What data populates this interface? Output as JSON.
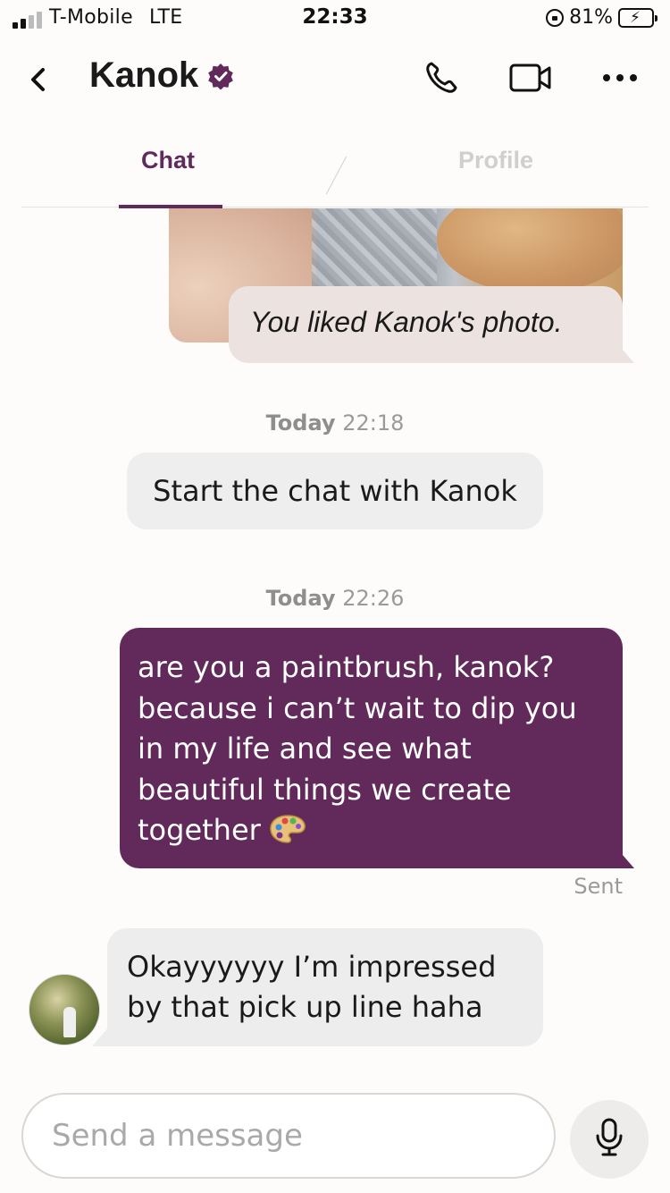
{
  "status_bar": {
    "carrier": "T-Mobile",
    "network": "LTE",
    "time": "22:33",
    "battery_percent": "81%",
    "battery_level": 0.81
  },
  "header": {
    "name": "Kanok",
    "icons": [
      "back-icon",
      "verified-badge-icon",
      "phone-icon",
      "video-icon",
      "more-icon"
    ]
  },
  "tabs": [
    {
      "label": "Chat",
      "active": true
    },
    {
      "label": "Profile",
      "active": false
    }
  ],
  "messages": {
    "liked_photo_note": "You liked Kanok's photo.",
    "group1": {
      "day": "Today",
      "time": "22:18"
    },
    "system_message": "Start the chat with Kanok",
    "group2": {
      "day": "Today",
      "time": "22:26"
    },
    "outgoing": {
      "lines": [
        "are you a paintbrush, kanok?",
        "because i can’t wait to dip you",
        "in my life and see what",
        "beautiful things we create",
        "together"
      ],
      "emoji": "palette-icon",
      "status": "Sent"
    },
    "incoming": {
      "lines": [
        "Okayyyyyy I’m impressed",
        "by that pick up line haha"
      ]
    }
  },
  "composer": {
    "placeholder": "Send a message",
    "mic_icon": "microphone-icon"
  },
  "colors": {
    "brand_purple": "#612a5b",
    "incoming_bubble": "#ededed",
    "liked_note_bubble": "#ece3e1"
  }
}
